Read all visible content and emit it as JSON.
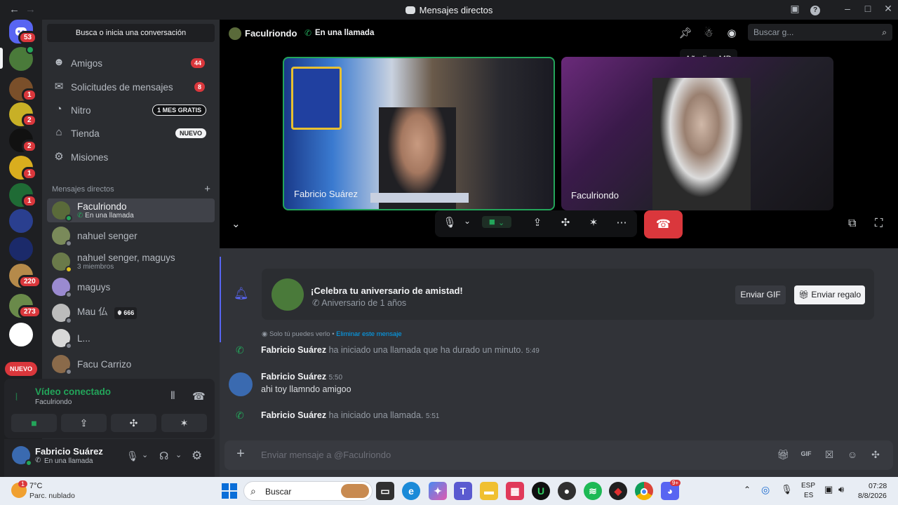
{
  "window": {
    "title": "Mensajes directos",
    "back_icon": "←",
    "forward_icon": "→"
  },
  "rail": {
    "home_badge": "53",
    "servers": [
      {
        "badge": "1",
        "color": "#7a4f2a"
      },
      {
        "badge": "2",
        "color": "#c8b026"
      },
      {
        "badge": "2",
        "color": "#111111"
      },
      {
        "badge": "1",
        "color": "#d9ad1e"
      },
      {
        "badge": "1",
        "color": "#1f6b35"
      },
      {
        "badge": "",
        "color": "#2a3f8f"
      },
      {
        "badge": "",
        "color": "#1b2a6a"
      },
      {
        "badge": "220",
        "color": "#b58a4a"
      },
      {
        "badge": "273",
        "color": "#6a8a4a"
      },
      {
        "badge": "",
        "color": "#ffffff"
      }
    ],
    "new_label": "NUEVO"
  },
  "sidebar": {
    "search_label": "Busca o inicia una conversación",
    "nav": [
      {
        "label": "Amigos",
        "badge": "44"
      },
      {
        "label": "Solicitudes de mensajes",
        "badge": "8"
      },
      {
        "label": "Nitro",
        "pill": "1 MES GRATIS"
      },
      {
        "label": "Tienda",
        "pill": "NUEVO"
      },
      {
        "label": "Misiones"
      }
    ],
    "dm_header": "Mensajes directos",
    "dms": [
      {
        "name": "Faculriondo",
        "sub": "En una llamada"
      },
      {
        "name": "nahuel senger",
        "sub": ""
      },
      {
        "name": "nahuel senger, maguys",
        "sub": "3 miembros"
      },
      {
        "name": "maguys",
        "sub": ""
      },
      {
        "name": "Mau 仏",
        "tag": "666"
      },
      {
        "name": "L...",
        "sub": ""
      },
      {
        "name": "Facu Carrizo",
        "sub": ""
      }
    ]
  },
  "voice": {
    "status": "Vídeo conectado",
    "channel": "Faculriondo"
  },
  "user": {
    "name": "Fabricio Suárez",
    "status": "En una llamada"
  },
  "call": {
    "header_name": "Faculriondo",
    "header_status": "En una llamada",
    "search_placeholder": "Buscar g...",
    "tooltip": "Añadir a MD",
    "tiles": [
      {
        "label": "Fabricio Suárez"
      },
      {
        "label": "Faculriondo"
      }
    ]
  },
  "chat": {
    "anniv_title": "¡Celebra tu aniversario de amistad!",
    "anniv_sub": "Aniversario de 1 años",
    "gif_button": "Enviar GIF",
    "gift_button": "Enviar regalo",
    "only_you": "Solo tú puedes verlo •",
    "delete_msg": "Eliminar este mensaje",
    "messages": [
      {
        "author": "Fabricio Suárez",
        "text": "ha iniciado una llamada que ha durado un minuto.",
        "time": "5:49"
      },
      {
        "author": "Fabricio Suárez",
        "time": "5:50",
        "text": "ahi toy llamndo amigoo"
      },
      {
        "author": "Fabricio Suárez",
        "text": "ha iniciado una llamada.",
        "time": "5:51"
      }
    ],
    "composer_placeholder": "Enviar mensaje a @Faculriondo"
  },
  "taskbar": {
    "weather_temp": "7°C",
    "weather_desc": "Parc. nublado",
    "weather_badge": "1",
    "search": "Buscar",
    "lang1": "ESP",
    "lang2": "ES",
    "time": "07:28",
    "date": "8/8/2026",
    "discord_badge": "9+"
  }
}
